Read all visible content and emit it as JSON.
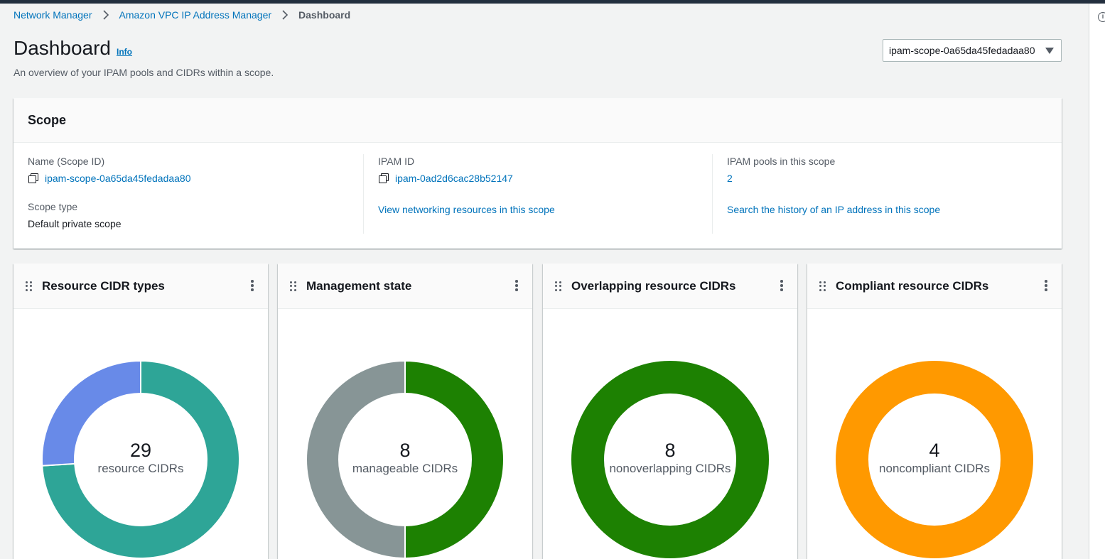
{
  "breadcrumb": {
    "items": [
      "Network Manager",
      "Amazon VPC IP Address Manager"
    ],
    "current": "Dashboard"
  },
  "header": {
    "title": "Dashboard",
    "info_label": "Info",
    "description": "An overview of your IPAM pools and CIDRs within a scope.",
    "scope_selector_value": "ipam-scope-0a65da45fedadaa80"
  },
  "scope_card": {
    "title": "Scope",
    "name_label": "Name (Scope ID)",
    "name_value": "ipam-scope-0a65da45fedadaa80",
    "type_label": "Scope type",
    "type_value": "Default private scope",
    "ipam_id_label": "IPAM ID",
    "ipam_id_value": "ipam-0ad2d6cac28b52147",
    "view_resources_link": "View networking resources in this scope",
    "pools_label": "IPAM pools in this scope",
    "pools_value": "2",
    "search_history_link": "Search the history of an IP address in this scope"
  },
  "widgets": [
    {
      "title": "Resource CIDR types",
      "count": "29",
      "subtitle": "resource CIDRs",
      "segments": [
        {
          "fraction": 0.74,
          "color": "#2ea597"
        },
        {
          "fraction": 0.26,
          "color": "#688ae8"
        }
      ]
    },
    {
      "title": "Management state",
      "count": "8",
      "subtitle": "manageable CIDRs",
      "segments": [
        {
          "fraction": 0.5,
          "color": "#1d8102"
        },
        {
          "fraction": 0.5,
          "color": "#879596"
        }
      ]
    },
    {
      "title": "Overlapping resource CIDRs",
      "count": "8",
      "subtitle": "nonoverlapping CIDRs",
      "segments": [
        {
          "fraction": 1.0,
          "color": "#1d8102"
        }
      ]
    },
    {
      "title": "Compliant resource CIDRs",
      "count": "4",
      "subtitle": "noncompliant CIDRs",
      "segments": [
        {
          "fraction": 1.0,
          "color": "#ff9900"
        }
      ]
    }
  ],
  "colors": {
    "link": "#0073bb",
    "topbar": "#232f3e"
  },
  "icons": {
    "breadcrumb_separator": "chevron-right-icon",
    "copy": "copy-icon",
    "drag": "drag-handle-icon",
    "menu": "more-vertical-icon",
    "dropdown": "caret-down-icon",
    "rail": "info-circle-icon"
  }
}
